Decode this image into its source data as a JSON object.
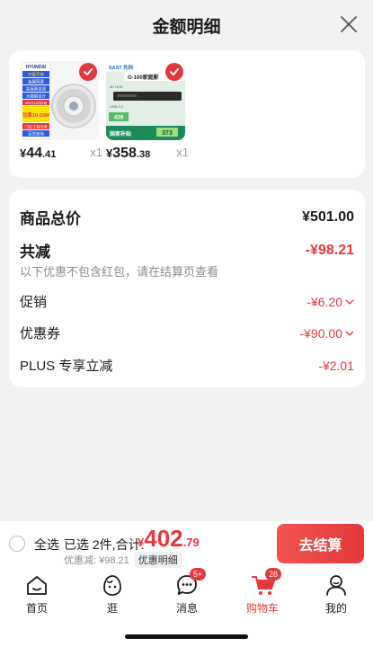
{
  "header": {
    "title": "金额明细"
  },
  "products": [
    {
      "currency": "¥",
      "price_int": "44",
      "price_dec": ".41",
      "qty": "x1",
      "image_text": [
        "HYUNDAI",
        "只换不修",
        "金属网罩",
        "高保真音质",
        "大磁钢设计",
        "650元以内价格",
        "功率10-20W",
        "门店/工程专用",
        "百货商场"
      ]
    },
    {
      "currency": "¥",
      "price_int": "358",
      "price_dec": ".38",
      "qty": "x1",
      "image_text": [
        "SAST 先科",
        "G-100家庭影",
        "4K UHD",
        "USB 2.0",
        "439",
        "373",
        "国家补贴"
      ]
    }
  ],
  "summary": {
    "goods_total_label": "商品总价",
    "goods_total_value": "¥501.00",
    "total_discount_label": "共减",
    "total_discount_value": "-¥98.21",
    "hint": "以下优惠不包含红包，请在结算页查看",
    "promotion_label": "促销",
    "promotion_value": "-¥6.20",
    "coupon_label": "优惠券",
    "coupon_value": "-¥90.00",
    "plus_label": "PLUS 专享立减",
    "plus_value": "-¥2.01"
  },
  "checkout": {
    "select_all": "全选",
    "selected_text": "已选 2件,合计:",
    "currency": "¥",
    "total_int": "402",
    "total_dec": ".79",
    "discount_text": "优惠减: ¥98.21",
    "detail_label": "优惠明细",
    "button_label": "去结算"
  },
  "tabbar": {
    "items": [
      {
        "label": "首页",
        "icon": "home-icon",
        "badge": ""
      },
      {
        "label": "逛",
        "icon": "face-icon",
        "badge": ""
      },
      {
        "label": "消息",
        "icon": "message-icon",
        "badge": "5+"
      },
      {
        "label": "购物车",
        "icon": "cart-icon",
        "badge": "28"
      },
      {
        "label": "我的",
        "icon": "profile-icon",
        "badge": ""
      }
    ]
  },
  "colors": {
    "accent": "#e4393c",
    "background": "#f2f2f2"
  }
}
